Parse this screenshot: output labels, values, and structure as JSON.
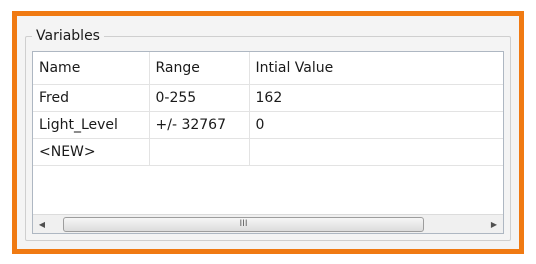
{
  "group": {
    "title": "Variables"
  },
  "table": {
    "columns": [
      "Name",
      "Range",
      "Intial Value"
    ],
    "rows": [
      [
        "Fred",
        "0-255",
        "162"
      ],
      [
        "Light_Level",
        "+/- 32767",
        "0"
      ],
      [
        "<NEW>",
        "",
        ""
      ]
    ]
  },
  "scrollbar": {
    "left_arrow": "◀",
    "right_arrow": "▶",
    "grip": "III",
    "position": 0.0
  },
  "colors": {
    "frame_border": "#f07a12",
    "panel_background": "#f4f4f4",
    "table_border": "#aeb7c2"
  }
}
